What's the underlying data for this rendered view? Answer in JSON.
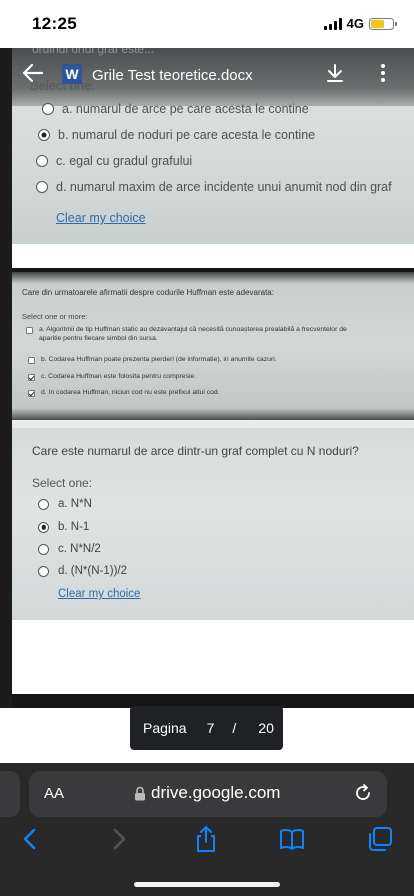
{
  "status_bar": {
    "time": "12:25",
    "network": "4G",
    "battery_level": 0.6
  },
  "document": {
    "title": "Grile Test teoretice.docx",
    "app_badge": "W"
  },
  "page1": {
    "cut_text": "ordinul unui graf este...",
    "select_label": "Select one:",
    "options": [
      {
        "text": "a. numarul de arce pe care acesta le contine",
        "checked": false
      },
      {
        "text": "b. numarul de noduri pe care acesta le contine",
        "checked": true
      },
      {
        "text": "c. egal cu gradul grafului",
        "checked": false
      },
      {
        "text": "d. numarul maxim de arce incidente unui anumit nod din graf",
        "checked": false
      }
    ],
    "clear_choice": "Clear my choice"
  },
  "page2": {
    "question": "Care din urmatoarele afirmatii despre codurile Huffman este adevarata:",
    "select_label": "Select one or more:",
    "options": [
      {
        "text": "a. Algoritmii de tip Huffman static au dezavantajul că necesită cunoașterea prealabilă a frecventelor de",
        "text2": "aparitie pentru fiecare simbol din sursa.",
        "checked": false
      },
      {
        "text": "b. Codarea Huffman poate prezenta pierderi (de informatie), in anumite cazuri.",
        "checked": false
      },
      {
        "text": "c. Codarea Huffman este folosita pentru compresie.",
        "checked": true
      },
      {
        "text": "d. In codarea Huffman, niciun cod nu este prefixul altui cod.",
        "checked": true
      }
    ]
  },
  "page3": {
    "question": "Care este numarul de arce dintr-un graf complet cu N noduri?",
    "select_label": "Select one:",
    "options": [
      {
        "text": "a. N*N",
        "checked": false
      },
      {
        "text": "b. N-1",
        "checked": true
      },
      {
        "text": "c. N*N/2",
        "checked": false
      },
      {
        "text": "d. (N*(N-1))/2",
        "checked": false
      }
    ],
    "clear_choice": "Clear my choice"
  },
  "pager": {
    "label": "Pagina",
    "current": "7",
    "separator": "/",
    "total": "20"
  },
  "safari": {
    "text_size_label": "AA",
    "url": "drive.google.com"
  },
  "icons": {
    "back": "back-arrow-icon",
    "download": "download-icon",
    "more": "more-vertical-icon",
    "lock": "lock-icon",
    "reload": "reload-icon",
    "nav_back": "chevron-left-icon",
    "nav_forward": "chevron-right-icon",
    "share": "share-icon",
    "bookmarks": "book-icon",
    "tabs": "tabs-icon"
  },
  "colors": {
    "link": "#2b6cb0",
    "word_brand": "#2b579a",
    "battery": "#f5c518",
    "safari_bar": "#292929",
    "safari_accent": "#0a84ff"
  }
}
